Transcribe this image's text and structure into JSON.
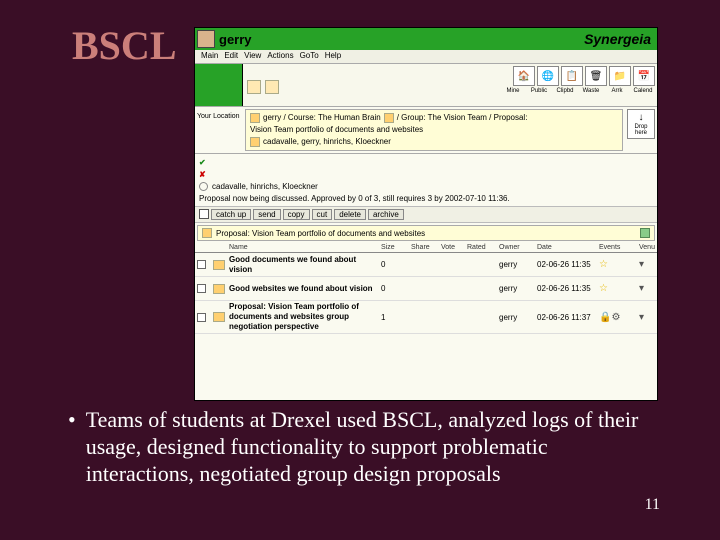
{
  "slide": {
    "title": "BSCL",
    "page_number": "11",
    "bullet": "Teams of students at Drexel used BSCL, analyzed logs of their usage, designed functionality to support problematic interactions, negotiated group design proposals"
  },
  "app": {
    "user": "gerry",
    "brand": "Synergeia",
    "menubar": [
      "Main",
      "Edit",
      "View",
      "Actions",
      "GoTo",
      "Help"
    ],
    "top_tools": {
      "icons": [
        "mine",
        "public",
        "clipbd",
        "waste",
        "arrk",
        "calend"
      ],
      "labels": [
        "Mine",
        "Public",
        "Clipbd",
        "Waste",
        "Arrk",
        "Calend"
      ]
    },
    "location": {
      "label": "Your Location",
      "line1": "gerry / Course: The Human Brain",
      "line1b": "/ Group: The Vision Team / Proposal:",
      "line2": "Vision Team portfolio of documents and websites",
      "members": "cadavalle, gerry, hinrichs, Kloeckner"
    },
    "drop_label": "Drop here",
    "review": {
      "voters": "cadavalle, hinrichs, Kloeckner",
      "status": "Proposal now being discussed. Approved by 0 of 3, still requires 3 by 2002-07-10 11:36."
    },
    "actions": {
      "catch_up": "catch up",
      "send": "send",
      "copy": "copy",
      "cut": "cut",
      "delete": "delete",
      "archive": "archive"
    },
    "panel_title": "Proposal: Vision Team portfolio of documents and websites",
    "columns": {
      "name": "Name",
      "size": "Size",
      "share": "Share",
      "vote": "Vote",
      "rated": "Rated",
      "owner": "Owner",
      "date": "Date",
      "events": "Events",
      "venu": "Venu"
    },
    "rows": [
      {
        "name": "Good documents we found about vision",
        "size": "0",
        "owner": "gerry",
        "date": "02-06-26 11:35",
        "events": "star"
      },
      {
        "name": "Good websites we found about vision",
        "size": "0",
        "owner": "gerry",
        "date": "02-06-26 11:35",
        "events": "star"
      },
      {
        "name": "Proposal: Vision Team portfolio of documents and websites group negotiation perspective",
        "size": "1",
        "owner": "gerry",
        "date": "02-06-26 11:37",
        "events": "lockgear"
      }
    ]
  }
}
